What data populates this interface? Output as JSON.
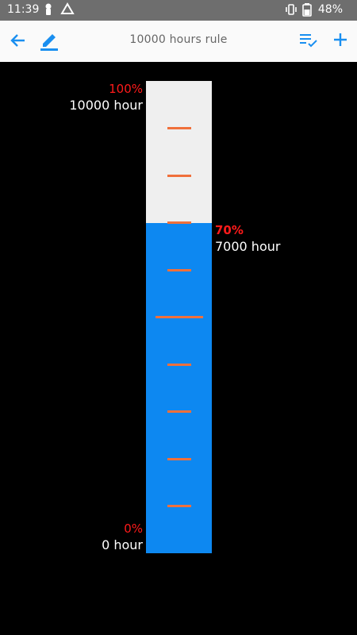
{
  "status_bar": {
    "time": "11:39",
    "battery": "48%",
    "icons": [
      "lock-person-icon",
      "drive-icon",
      "vibrate-icon",
      "battery-icon"
    ]
  },
  "app_bar": {
    "title": "10000  hours rule",
    "left_icons": [
      "back-arrow-icon",
      "edit-pencil-icon"
    ],
    "right_icons": [
      "checklist-icon",
      "add-icon"
    ],
    "accent": "#1a8ff0"
  },
  "gauge": {
    "progress_fraction": 0.7,
    "colors": {
      "fill": "#0d88f1",
      "empty": "#efefef",
      "tick": "#f0703b",
      "pct_text": "#ff1a1a"
    },
    "top": {
      "pct": "100%",
      "hours": "10000 hour"
    },
    "current": {
      "pct": "70%",
      "hours": "7000 hour"
    },
    "bottom": {
      "pct": "0%",
      "hours": "0 hour"
    }
  }
}
